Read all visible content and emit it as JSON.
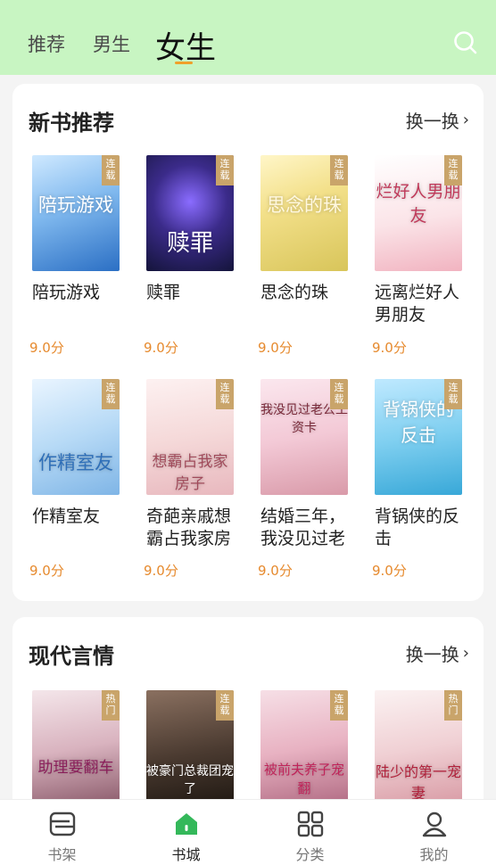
{
  "header": {
    "tabs": [
      "推荐",
      "男生",
      "女生"
    ],
    "active_tab": "女生",
    "accent_color": "#f0a02a",
    "bg_color": "#c8f5c2"
  },
  "sections": [
    {
      "title": "新书推荐",
      "refresh_label": "换一换",
      "books": [
        {
          "title": "陪玩游戏",
          "score": "9.0分",
          "badge": "连载",
          "cover_text": "陪玩游戏"
        },
        {
          "title": "赎罪",
          "score": "9.0分",
          "badge": "连载",
          "cover_text": "赎罪"
        },
        {
          "title": "思念的珠",
          "score": "9.0分",
          "badge": "连载",
          "cover_text": "思念的珠"
        },
        {
          "title": "远离烂好人男朋友",
          "score": "9.0分",
          "badge": "连载",
          "cover_text": "烂好人男朋友"
        },
        {
          "title": "作精室友",
          "score": "9.0分",
          "badge": "连载",
          "cover_text": "作精室友"
        },
        {
          "title": "奇葩亲戚想霸占我家房",
          "score": "9.0分",
          "badge": "连载",
          "cover_text": "想霸占我家房子"
        },
        {
          "title": "结婚三年，我没见过老",
          "score": "9.0分",
          "badge": "连载",
          "cover_text": "我没见过老公工资卡"
        },
        {
          "title": "背锅侠的反击",
          "score": "9.0分",
          "badge": "连载",
          "cover_text": "背锅侠的反击"
        }
      ]
    },
    {
      "title": "现代言情",
      "refresh_label": "换一换",
      "books": [
        {
          "badge": "热门",
          "cover_text": "助理要翻车"
        },
        {
          "badge": "连载",
          "cover_text": "被豪门总裁团宠了"
        },
        {
          "badge": "连载",
          "cover_text": "被前夫养子宠翻"
        },
        {
          "badge": "热门",
          "cover_text": "陆少的第一宠妻"
        }
      ]
    }
  ],
  "bottom_nav": [
    {
      "label": "书架",
      "icon": "bookshelf-icon"
    },
    {
      "label": "书城",
      "icon": "bookstore-icon",
      "active": true
    },
    {
      "label": "分类",
      "icon": "category-icon"
    },
    {
      "label": "我的",
      "icon": "profile-icon"
    }
  ]
}
